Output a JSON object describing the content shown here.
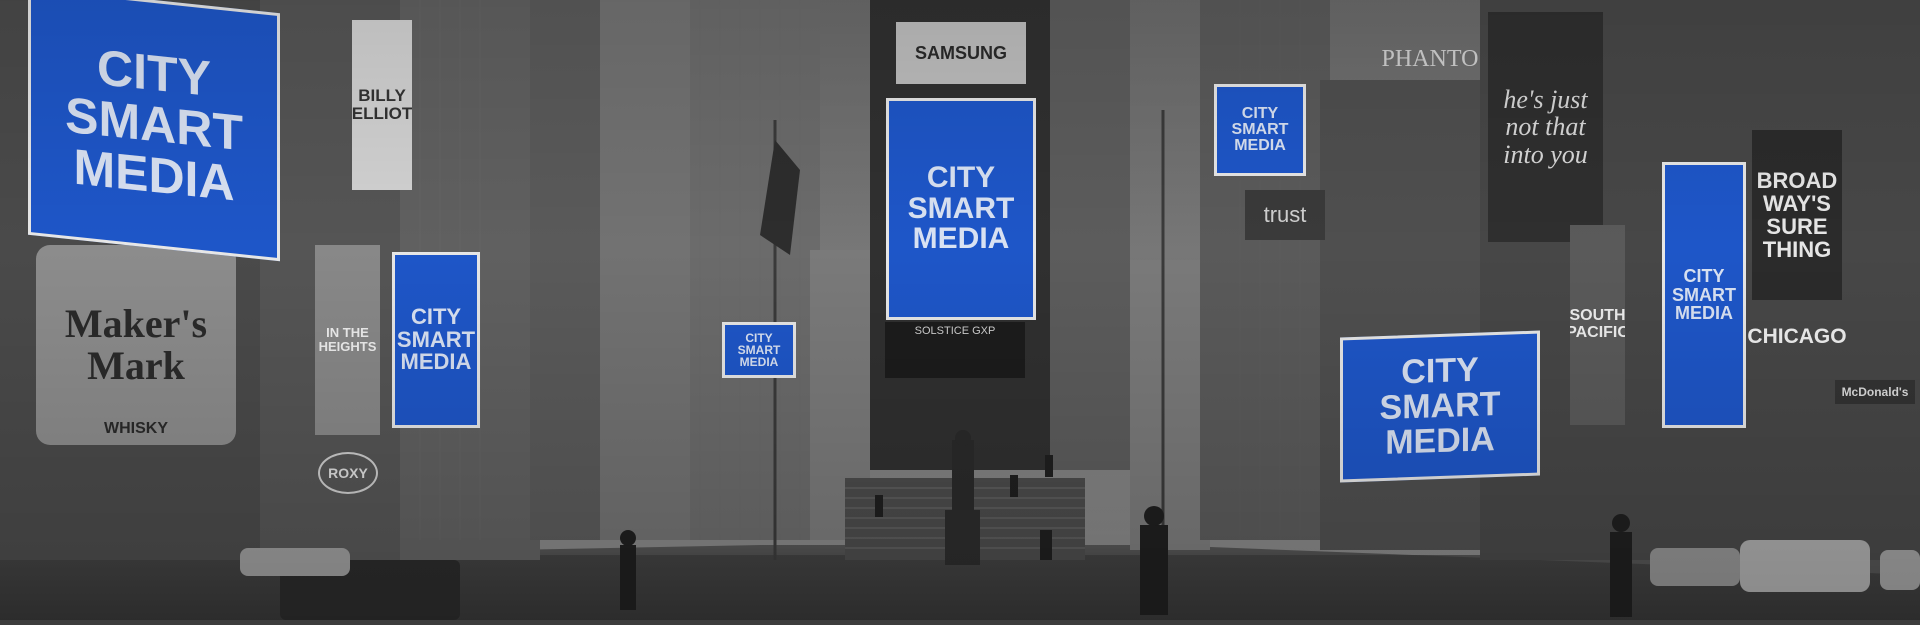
{
  "billboards": [
    {
      "id": "large-left",
      "text": "CITY\nSMART\nMEDIA"
    },
    {
      "id": "mid-left",
      "text": "CITY\nSMART\nMEDIA"
    },
    {
      "id": "small-center-left",
      "text": "CITY\nSMART\nMEDIA"
    },
    {
      "id": "center-tower",
      "text": "CITY\nSMART\nMEDIA"
    },
    {
      "id": "upper-right-small",
      "text": "CITY\nSMART\nMEDIA"
    },
    {
      "id": "right-lower",
      "text": "CITY\nSMART\nMEDIA"
    },
    {
      "id": "far-right-vertical",
      "text": "CITY\nSMART\nMEDIA"
    }
  ],
  "signs": {
    "makers_mark": "Maker's\nMark",
    "makers_whisky": "WHISKY",
    "samsung": "SAMSUNG",
    "solstice": "SOLSTICE GXP",
    "phantom": "PHANTO",
    "hes_just": "he's just\nnot that\ninto you",
    "broadway": "BROAD\nWAY'S\nSURE\nTHING",
    "chicago": "CHICAGO",
    "mcdonalds": "McDonald's",
    "south_pacific": "SOUTH\nPACIFIC",
    "trust": "trust",
    "roxy": "ROXY",
    "heights": "IN THE\nHEIGHTS",
    "billy_elliot": "BILLY\nELLIOT"
  },
  "colors": {
    "billboard_blue": "#1e56c8",
    "billboard_text": "#d9e2f3",
    "scene_gray": "#3c3c3c"
  }
}
